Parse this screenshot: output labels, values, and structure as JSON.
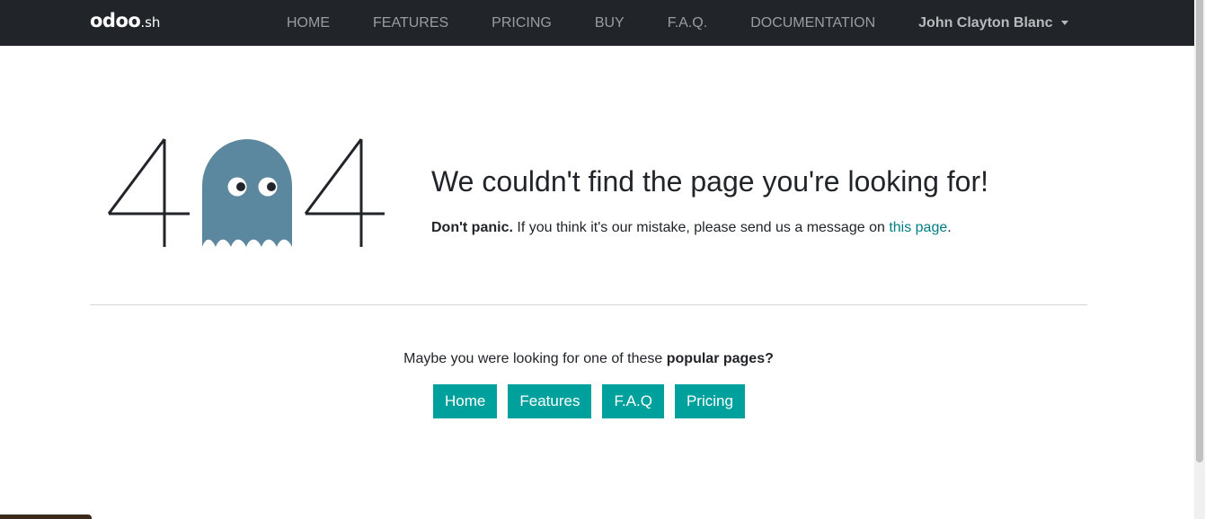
{
  "navbar": {
    "brand_main": "odoo",
    "brand_suffix": ".sh",
    "links": [
      "HOME",
      "FEATURES",
      "PRICING",
      "BUY",
      "F.A.Q.",
      "DOCUMENTATION"
    ],
    "user": "John Clayton Blanc"
  },
  "error": {
    "code_left": "4",
    "code_right": "4",
    "headline": "We couldn't find the page you're looking for!",
    "panic_bold": "Don't panic.",
    "message": " If you think it's our mistake, please send us a message on ",
    "link_text": "this page",
    "message_end": "."
  },
  "popular": {
    "text": "Maybe you were looking for one of these ",
    "text_bold": "popular pages?",
    "buttons": [
      "Home",
      "Features",
      "F.A.Q",
      "Pricing"
    ]
  },
  "colors": {
    "navbar_bg": "#212529",
    "ghost": "#5b889f",
    "accent": "#00a09d",
    "link": "#017e84"
  }
}
